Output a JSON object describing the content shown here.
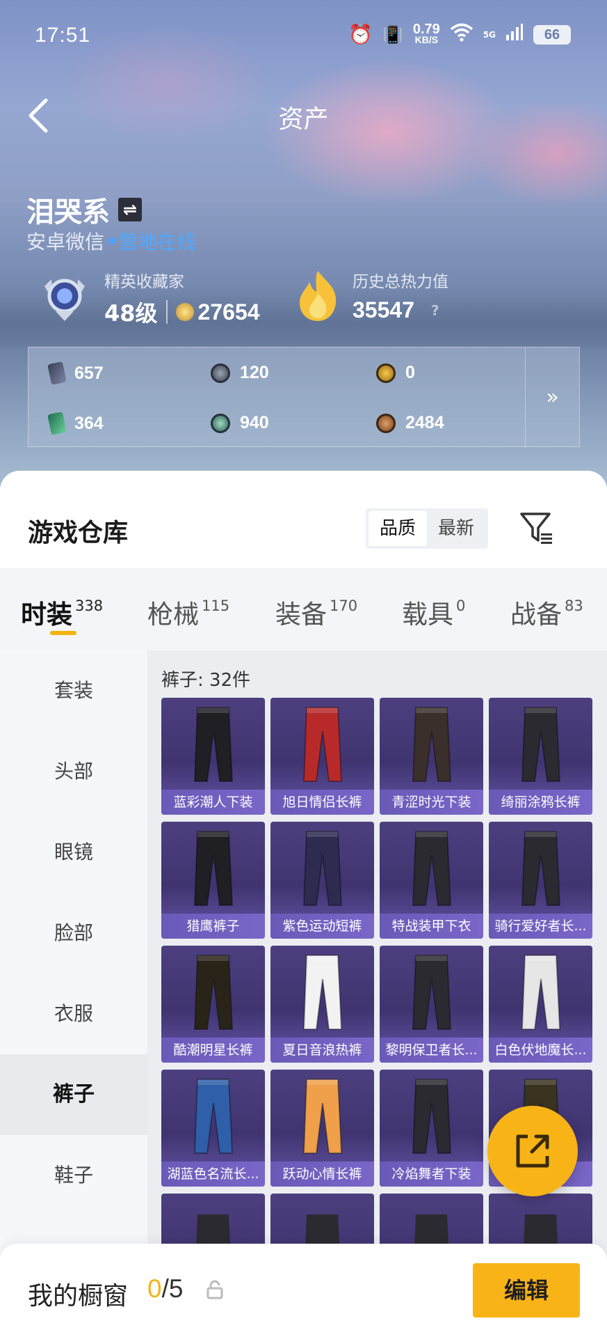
{
  "status_bar": {
    "time": "17:51",
    "net_speed": "0.79",
    "net_unit": "KB/S",
    "signal": "5G",
    "battery": "66"
  },
  "header": {
    "title": "资产"
  },
  "profile": {
    "name": "泪哭系",
    "platform": "安卓微信",
    "online": "营地在线",
    "rank_label": "精英收藏家",
    "rank_level": "48级",
    "rank_points": "27654",
    "heat_label": "历史总热力值",
    "heat_value": "35547",
    "help": "?"
  },
  "currencies": [
    {
      "icon": "card-icon",
      "value": "657"
    },
    {
      "icon": "silver-coin-icon",
      "value": "120"
    },
    {
      "icon": "gold-coin-icon",
      "value": "0"
    },
    {
      "icon": "green-card-icon",
      "value": "364"
    },
    {
      "icon": "teal-coin-icon",
      "value": "940"
    },
    {
      "icon": "bronze-coin-icon",
      "value": "2484"
    }
  ],
  "currency_more": "»",
  "warehouse": {
    "title": "游戏仓库",
    "sort_options": [
      "品质",
      "最新"
    ],
    "sort_active": "品质"
  },
  "tabs": [
    {
      "label": "时装",
      "count": "338"
    },
    {
      "label": "枪械",
      "count": "115"
    },
    {
      "label": "装备",
      "count": "170"
    },
    {
      "label": "载具",
      "count": "0"
    },
    {
      "label": "战备",
      "count": "83"
    }
  ],
  "side_nav": [
    "套装",
    "头部",
    "眼镜",
    "脸部",
    "衣服",
    "裤子",
    "鞋子"
  ],
  "side_active": "裤子",
  "grid": {
    "heading": "裤子: 32件",
    "items": [
      "蓝彩潮人下装",
      "旭日情侣长裤",
      "青涩时光下装",
      "绮丽涂鸦长裤",
      "猎鹰裤子",
      "紫色运动短裤",
      "特战装甲下衣",
      "骑行爱好者长...",
      "酷潮明星长裤",
      "夏日音浪热裤",
      "黎明保卫者长...",
      "白色伏地魔长...",
      "湖蓝色名流长...",
      "跃动心情长裤",
      "冷焰舞者下装",
      "长裤"
    ]
  },
  "bottom_bar": {
    "label": "我的橱窗",
    "current": "0",
    "total": "/5",
    "edit": "编辑"
  },
  "colors": {
    "accent": "#f8b417",
    "online_blue": "#4ea9ff",
    "card_purple": "#4d3f7f"
  }
}
